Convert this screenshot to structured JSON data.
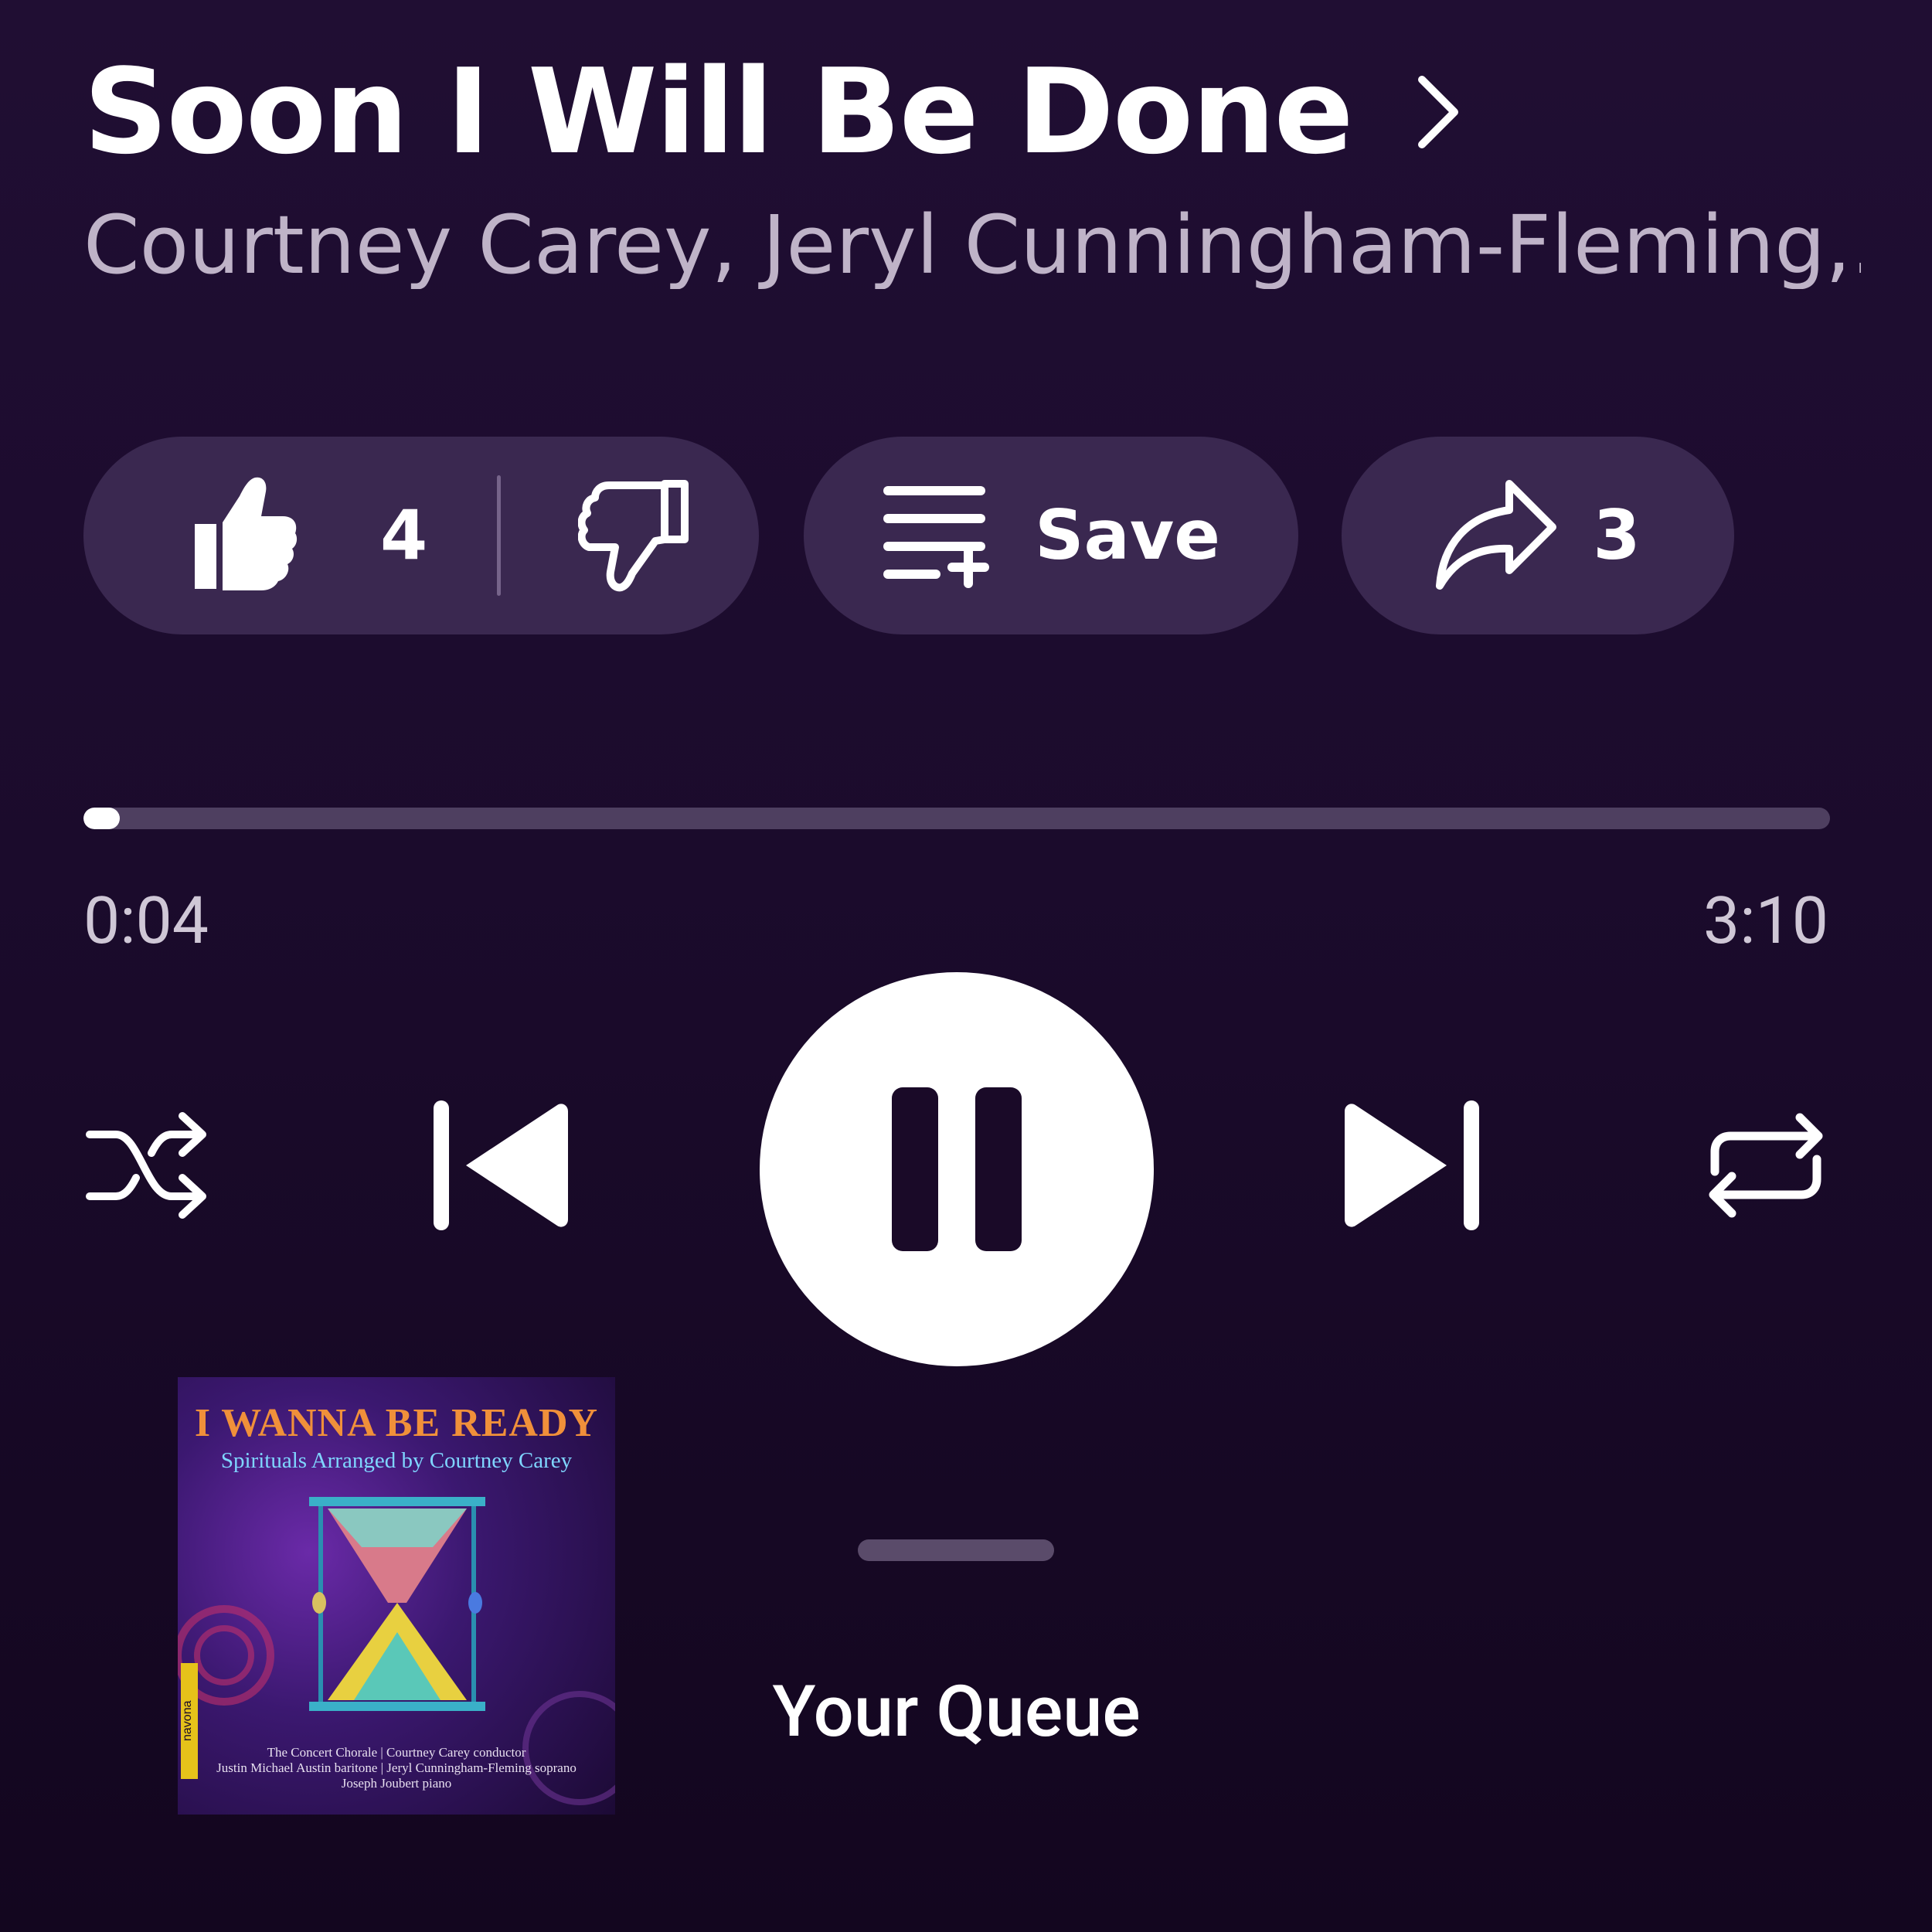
{
  "now_playing": {
    "title": "Soon I Will Be Done",
    "artists": "Courtney Carey, Jeryl Cunningham-Fleming,..."
  },
  "actions": {
    "like_count": "4",
    "save_label": "Save",
    "share_count": "3"
  },
  "playback": {
    "elapsed": "0:04",
    "total": "3:10",
    "progress_fraction": 0.021
  },
  "controls": {
    "shuffle_icon": "shuffle-icon",
    "previous_icon": "skip-previous-icon",
    "play_pause_icon": "pause-icon",
    "next_icon": "skip-next-icon",
    "repeat_icon": "repeat-icon"
  },
  "album": {
    "title": "I WANNA BE READY",
    "subtitle": "Spirituals Arranged by Courtney Carey",
    "label": "navona",
    "credit_1": "The Concert Chorale | Courtney Carey conductor",
    "credit_2": "Justin Michael Austin baritone | Jeryl Cunningham-Fleming soprano",
    "credit_3": "Joseph Joubert piano"
  },
  "queue": {
    "label": "Your Queue"
  },
  "colors": {
    "background": "#1b0b2c",
    "pill": "#3a2850",
    "secondary_text": "#bfb3c8",
    "progress_track": "#4e3f60"
  }
}
